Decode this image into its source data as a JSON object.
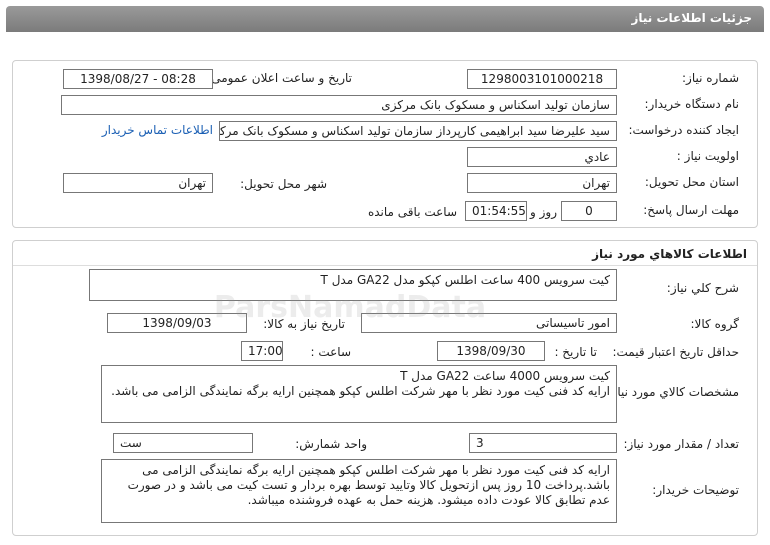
{
  "window": {
    "title": "جزئیات اطلاعات نیاز"
  },
  "header": {
    "need_number_label": "شماره نیاز:",
    "need_number": "1298003101000218",
    "announce_label": "تاریخ و ساعت اعلان عمومی:",
    "announce_value": "1398/08/27 - 08:28",
    "buyer_label": "نام دستگاه خریدار:",
    "buyer_value": "سازمان تولید اسکناس و مسکوک بانک مرکزی",
    "creator_label": "ایجاد کننده درخواست:",
    "creator_value": "سید علیرضا سید ابراهیمی کارپرداز سازمان تولید اسکناس و مسکوک بانک مرکزی",
    "contact_link": "اطلاعات تماس خریدار",
    "priority_label": "اولویت نیاز :",
    "priority_value": "عادي",
    "province_label": "استان محل تحویل:",
    "province_value": "تهران",
    "city_label": "شهر محل تحویل:",
    "city_value": "تهران",
    "deadline_label": "مهلت ارسال پاسخ:",
    "days_value": "0",
    "days_label": "روز و",
    "time_value": "01:54:55",
    "remaining_label": "ساعت باقی مانده"
  },
  "goods": {
    "section_title": "اطلاعات کالاهاي مورد نياز",
    "summary_label": "شرح کلي نياز:",
    "summary_value": "کیت سرویس 400 ساعت اطلس کپکو مدل GA22 مدل T",
    "group_label": "گروه کالا:",
    "group_value": "امور تاسیساتی",
    "need_date_label": "تاریخ نیاز به کالا:",
    "need_date_value": "1398/09/03",
    "validity_label": "حداقل تاریخ اعتبار قیمت:",
    "validity_to_label": "تا تاریخ :",
    "validity_date": "1398/09/30",
    "validity_hour_label": "ساعت :",
    "validity_hour": "17:00",
    "spec_label": "مشخصات کالاي مورد نياز:",
    "spec_line1": "کیت سرویس 4000 ساعت GA22 مدل T",
    "spec_line2": "ارایه کد فنی کیت مورد نظر با مهر شرکت اطلس کپکو همچنین ارایه برگه نمایندگی الزامی می باشد.",
    "qty_label": "تعداد / مقدار مورد نياز:",
    "qty_value": "3",
    "unit_label": "واحد شمارش:",
    "unit_value": "ست",
    "buyer_notes_label": "توضيحات خريدار:",
    "buyer_notes": "ارایه کد فنی کیت مورد نظر با مهر شرکت اطلس کپکو همچنین ارایه برگه نمایندگی الزامی می باشد.پرداخت 10 روز پس ازتحویل کالا وتایید توسط بهره بردار و تست کیت می باشد و در صورت عدم تطابق کالا عودت داده میشود. هزینه حمل به عهده فروشنده میباشد."
  },
  "watermark": {
    "brand": "ParsNamadData"
  }
}
